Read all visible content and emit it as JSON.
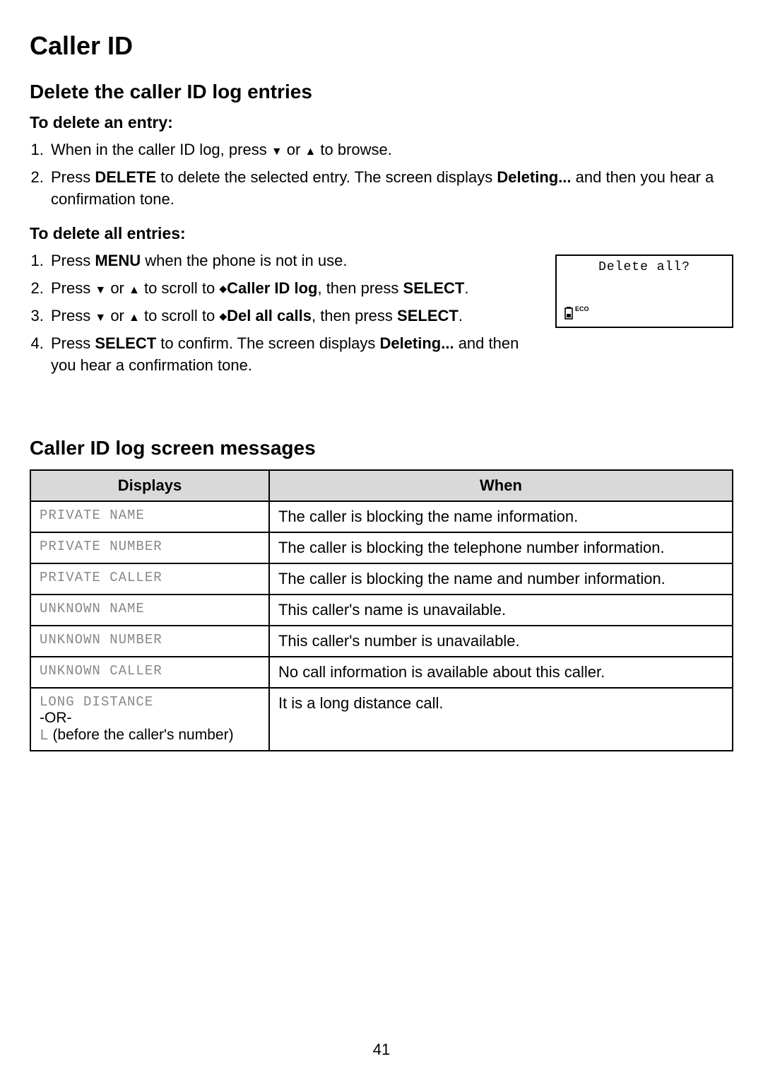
{
  "page_title": "Caller ID",
  "section1": {
    "heading": "Delete the caller ID log entries",
    "sub1": {
      "heading": "To delete an entry:",
      "steps": [
        {
          "prefix": "When in the caller ID log, press ",
          "mid": " or ",
          "suffix": " to browse."
        },
        {
          "prefix": "Press ",
          "bold1": "DELETE",
          "mid1": " to delete the selected entry. The screen displays ",
          "bold2": "Deleting...",
          "suffix": " and then you hear a confirmation tone."
        }
      ]
    },
    "sub2": {
      "heading": "To delete all entries:",
      "steps": [
        {
          "prefix": "Press ",
          "bold1": "MENU",
          "suffix": " when the phone is not in use."
        },
        {
          "prefix": "Press ",
          "mid1": " or ",
          "mid2": " to scroll to ",
          "bold1": "Caller ID log",
          "mid3": ", then press ",
          "bold2": "SELECT",
          "suffix": "."
        },
        {
          "prefix": "Press ",
          "mid1": " or ",
          "mid2": " to scroll to ",
          "bold1": "Del all calls",
          "mid3": ", then press ",
          "bold2": "SELECT",
          "suffix": "."
        },
        {
          "prefix": "Press ",
          "bold1": "SELECT",
          "mid1": " to confirm. The screen displays ",
          "bold2": "Deleting...",
          "suffix": " and then you hear a confirmation tone."
        }
      ]
    }
  },
  "screen": {
    "text": "Delete all?",
    "eco": "ECO"
  },
  "section2": {
    "heading": "Caller ID log screen messages",
    "headers": [
      "Displays",
      "When"
    ],
    "rows": [
      {
        "display": "PRIVATE NAME",
        "when": "The caller is blocking the name information."
      },
      {
        "display": "PRIVATE NUMBER",
        "when": "The caller is blocking the telephone number information."
      },
      {
        "display": "PRIVATE CALLER",
        "when": "The caller is blocking the name and number information."
      },
      {
        "display": "UNKNOWN NAME",
        "when": "This caller's name is unavailable."
      },
      {
        "display": "UNKNOWN NUMBER",
        "when": "This caller's number is unavailable."
      },
      {
        "display": "UNKNOWN CALLER",
        "when": "No call information is available about this caller."
      },
      {
        "display": "LONG DISTANCE",
        "or": "-OR-",
        "l_prefix": "L",
        "l_note": " (before the caller's number)",
        "when": "It is a long distance call."
      }
    ]
  },
  "page_number": "41"
}
